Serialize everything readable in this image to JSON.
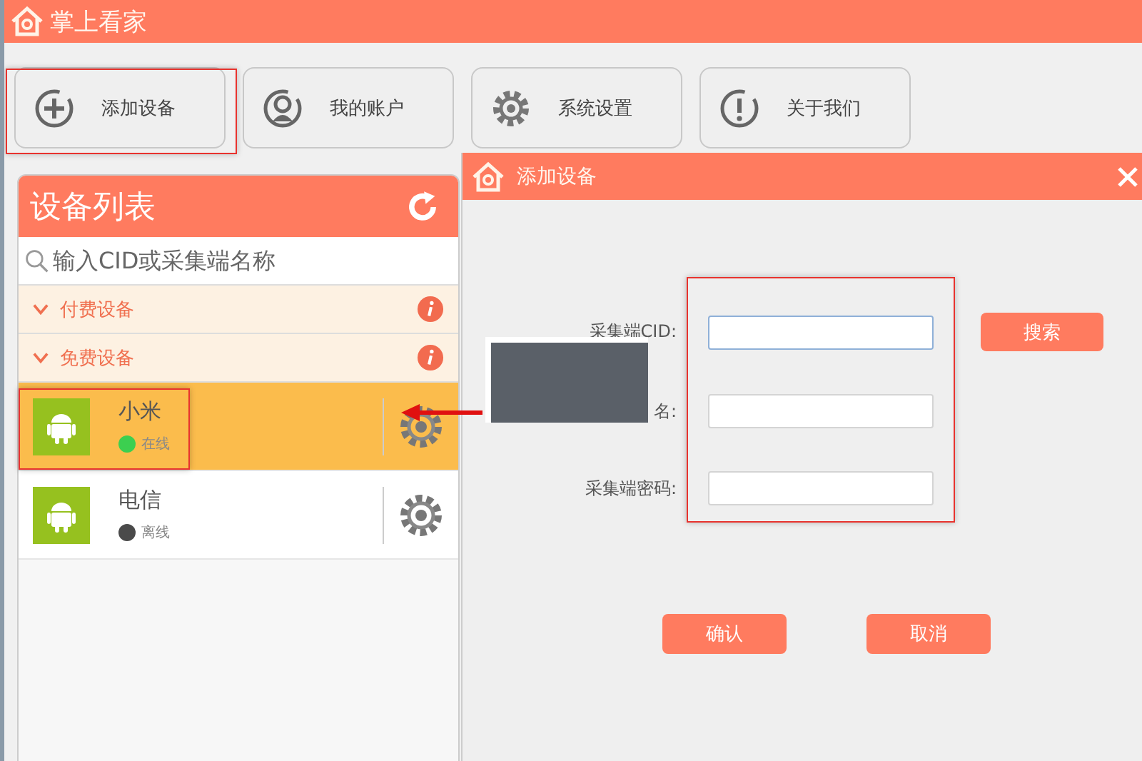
{
  "window": {
    "title": "掌上看家"
  },
  "toolbar": [
    {
      "kind": "add",
      "label": "添加设备"
    },
    {
      "kind": "account",
      "label": "我的账户"
    },
    {
      "kind": "settings",
      "label": "系统设置"
    },
    {
      "kind": "about",
      "label": "关于我们"
    }
  ],
  "device_list": {
    "title": "设备列表",
    "search": {
      "placeholder": "输入CID或采集端名称"
    },
    "groups": [
      {
        "label": "付费设备",
        "expanded": true
      },
      {
        "label": "免费设备",
        "expanded": true
      }
    ],
    "devices": [
      {
        "name": "小米",
        "status": "在线",
        "online": true,
        "selected": true
      },
      {
        "name": "电信",
        "status": "离线",
        "online": false,
        "selected": false
      }
    ]
  },
  "dialog": {
    "title": "添加设备",
    "fields": [
      {
        "label": "采集端CID:",
        "focused": true
      },
      {
        "label": "名:",
        "focused": false
      },
      {
        "label": "采集端密码:",
        "focused": false
      }
    ],
    "search_button": "搜索",
    "buttons": [
      "确认",
      "取消"
    ]
  }
}
